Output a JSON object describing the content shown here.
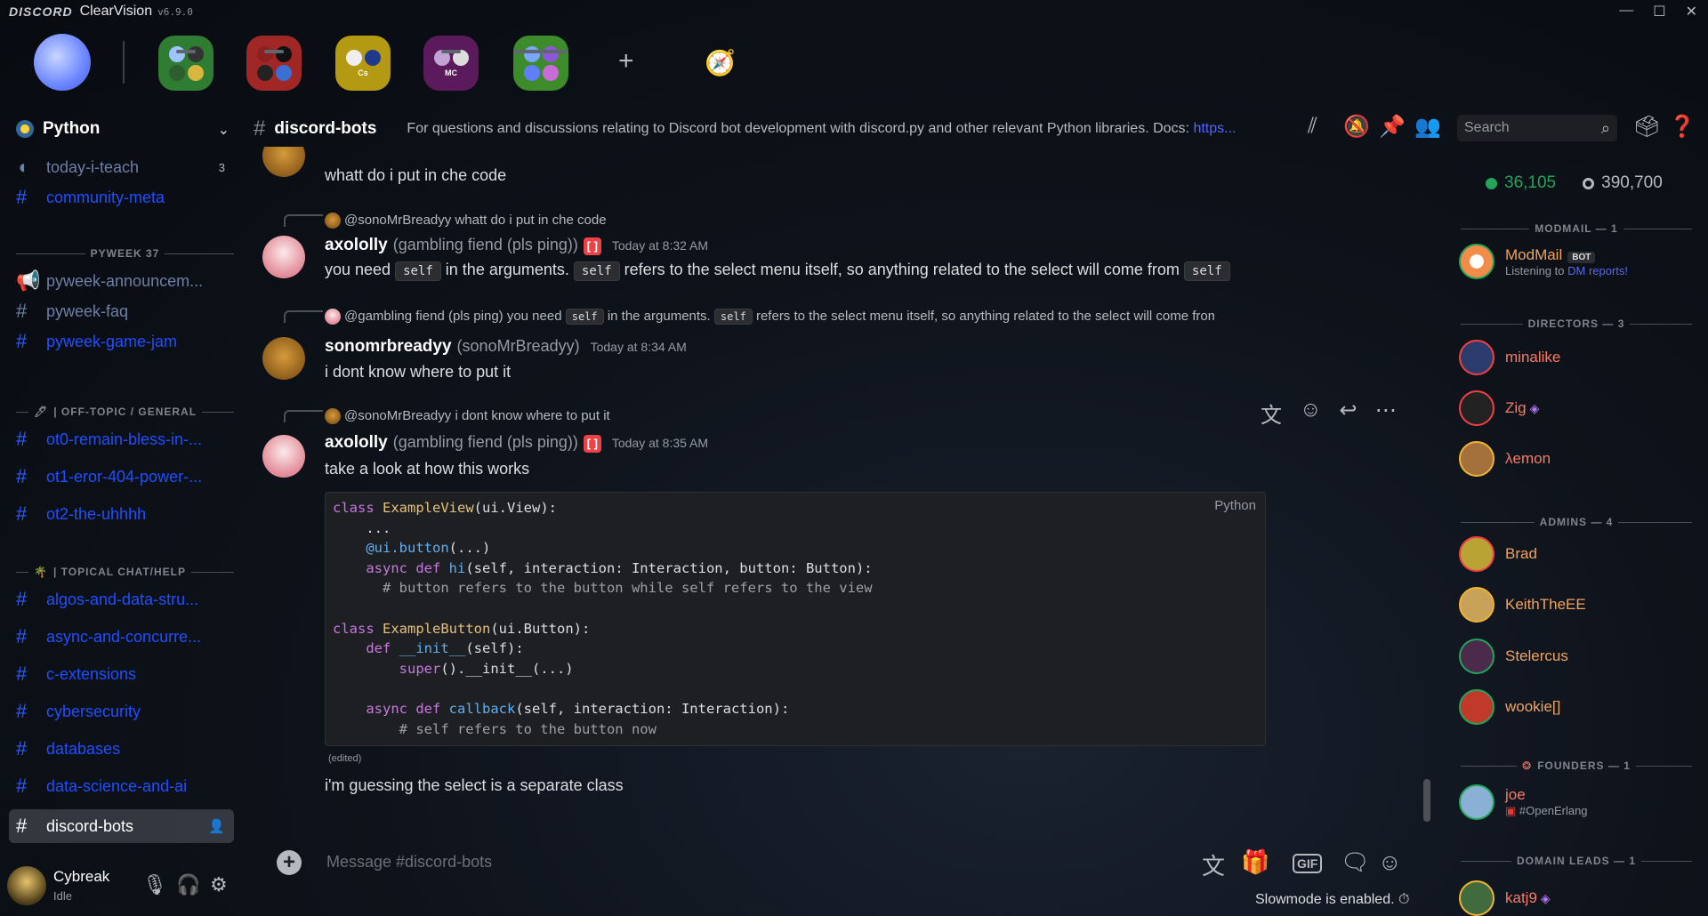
{
  "titlebar": {
    "logo": "DISCORD",
    "app": "ClearVision",
    "version": "v6.9.0",
    "minimize": "—",
    "maximize": "☐",
    "close": "✕"
  },
  "servers": [
    {
      "name": "server-1",
      "colors": [
        "#2ea043",
        "#38a169"
      ],
      "label": ""
    },
    {
      "name": "server-2",
      "colors": [
        "#c53030",
        "#9b2c2c"
      ],
      "label": ""
    },
    {
      "name": "server-3",
      "colors": [
        "#b7a11e",
        "#d4b106"
      ],
      "label": "Cs"
    },
    {
      "name": "server-4",
      "colors": [
        "#6b1f6b",
        "#8a2b8a"
      ],
      "label": "MC"
    },
    {
      "name": "server-5",
      "colors": [
        "#3f9b2f",
        "#6ab04c"
      ],
      "label": ""
    }
  ],
  "guild": {
    "name": "Python"
  },
  "channels": {
    "c1": {
      "name": "today-i-teach",
      "badge": "3"
    },
    "c2": {
      "name": "community-meta"
    },
    "cat1": "PYWEEK 37",
    "c3": {
      "name": "pyweek-announcem..."
    },
    "c4": {
      "name": "pyweek-faq"
    },
    "c5": {
      "name": "pyweek-game-jam"
    },
    "cat2": "| OFF-TOPIC / GENERAL",
    "c6": {
      "name": "ot0-remain-bless-in-..."
    },
    "c7": {
      "name": "ot1-eror-404-power-..."
    },
    "c8": {
      "name": "ot2-the-uhhhh"
    },
    "cat3": "| TOPICAL CHAT/HELP",
    "c9": {
      "name": "algos-and-data-stru..."
    },
    "c10": {
      "name": "async-and-concurre..."
    },
    "c11": {
      "name": "c-extensions"
    },
    "c12": {
      "name": "cybersecurity"
    },
    "c13": {
      "name": "databases"
    },
    "c14": {
      "name": "data-science-and-ai"
    },
    "c15": {
      "name": "discord-bots"
    }
  },
  "user": {
    "name": "Cybreak",
    "status": "Idle"
  },
  "header": {
    "channel": "discord-bots",
    "topic": "For questions and discussions relating to Discord bot development with discord.py and other relevant Python libraries. Docs: ",
    "topic_link": "https..."
  },
  "search": {
    "placeholder": "Search"
  },
  "messages": {
    "m0": {
      "text": "whatt do i put in che code"
    },
    "m1": {
      "reply_author": "@sonoMrBreadyy",
      "reply_text": "whatt do i put in che code",
      "author": "axololly",
      "nick": "(gambling fiend (pls ping))",
      "tag": "[ ]",
      "time": "Today at 8:32 AM",
      "t1": "you need ",
      "code1": "self",
      "t2": " in the arguments. ",
      "code2": "self",
      "t3": " refers to the select menu itself, so anything related to the select will come from ",
      "code3": "self"
    },
    "m2": {
      "reply_author": "@gambling fiend (pls ping)",
      "reply_t1": "you need",
      "reply_c1": "self",
      "reply_t2": "in the arguments.",
      "reply_c2": "self",
      "reply_t3": "refers to the select menu itself, so anything related to the select will come from",
      "reply_c3": "self",
      "author": "sonomrbreadyy",
      "nick": "(sonoMrBreadyy)",
      "time": "Today at 8:34 AM",
      "text": "i dont know where to put it"
    },
    "m3": {
      "reply_author": "@sonoMrBreadyy",
      "reply_text": "i dont know where to put it",
      "author": "axololly",
      "nick": "(gambling fiend (pls ping))",
      "tag": "[ ]",
      "time": "Today at 8:35 AM",
      "text": "take a look at how this works",
      "code_lang": "Python",
      "edited": "(edited)",
      "text2": "i'm guessing the select is a separate class"
    }
  },
  "composer": {
    "placeholder": "Message #discord-bots",
    "slowmode": "Slowmode is enabled."
  },
  "members": {
    "online": "36,105",
    "total": "390,700",
    "cat_modmail": "MODMAIL — 1",
    "modmail": {
      "name": "ModMail",
      "tag": "BOT",
      "activity_pre": "Listening to ",
      "activity": "DM reports!"
    },
    "cat_directors": "DIRECTORS — 3",
    "d1": "minalike",
    "d2": "Zig",
    "d3": "λemon",
    "cat_admins": "ADMINS — 4",
    "a1": "Brad",
    "a2": "KeithTheEE",
    "a3": "Stelercus",
    "a4": "wookie[]",
    "cat_founders": "FOUNDERS — 1",
    "f1": {
      "name": "joe",
      "sub": "#OpenErlang"
    },
    "cat_domain": "DOMAIN LEADS — 1",
    "dl1": "katj9"
  },
  "colors": {
    "director": "#f47b67",
    "admin": "#f0a35e",
    "modmail": "#f0a35e",
    "founder": "#f47b67",
    "domain": "#f47b67",
    "channel_unread": "#1f4fff"
  }
}
